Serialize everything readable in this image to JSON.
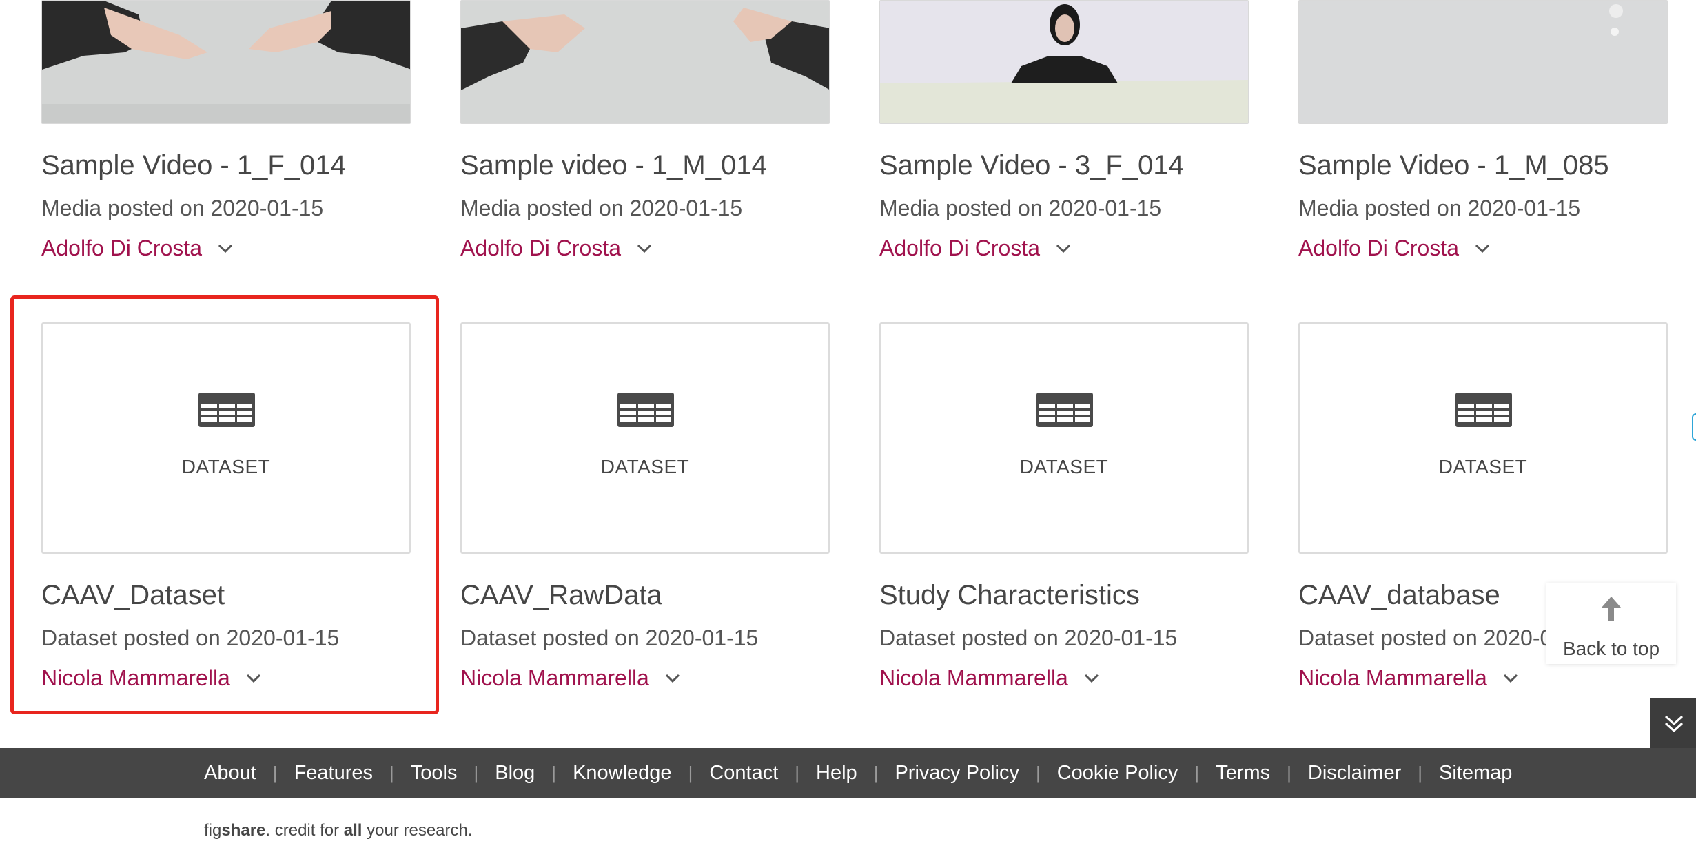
{
  "video_cards": [
    {
      "title": "Sample Video - 1_F_014",
      "posted": "Media posted on 2020-01-15",
      "author": "Adolfo Di Crosta",
      "thumb": "hands-on-table"
    },
    {
      "title": "Sample video - 1_M_014",
      "posted": "Media posted on 2020-01-15",
      "author": "Adolfo Di Crosta",
      "thumb": "hands-on-table"
    },
    {
      "title": "Sample Video - 3_F_014",
      "posted": "Media posted on 2020-01-15",
      "author": "Adolfo Di Crosta",
      "thumb": "person-at-table"
    },
    {
      "title": "Sample Video - 1_M_085",
      "posted": "Media posted on 2020-01-15",
      "author": "Adolfo Di Crosta",
      "thumb": "blank-table"
    }
  ],
  "dataset_cards": [
    {
      "type_label": "DATASET",
      "title": "CAAV_Dataset",
      "posted": "Dataset posted on 2020-01-15",
      "author": "Nicola Mammarella"
    },
    {
      "type_label": "DATASET",
      "title": "CAAV_RawData",
      "posted": "Dataset posted on 2020-01-15",
      "author": "Nicola Mammarella"
    },
    {
      "type_label": "DATASET",
      "title": "Study Characteristics",
      "posted": "Dataset posted on 2020-01-15",
      "author": "Nicola Mammarella"
    },
    {
      "type_label": "DATASET",
      "title": "CAAV_database",
      "posted": "Dataset posted on 2020-0",
      "author": "Nicola Mammarella"
    }
  ],
  "back_to_top": {
    "label": "Back to top",
    "icon": "arrow-up-icon"
  },
  "collapse_icon": "double-chevron-down-icon",
  "footer": {
    "links": [
      "About",
      "Features",
      "Tools",
      "Blog",
      "Knowledge",
      "Contact",
      "Help",
      "Privacy Policy",
      "Cookie Policy",
      "Terms",
      "Disclaimer",
      "Sitemap"
    ],
    "separator": "|"
  },
  "tagline": {
    "fig": "fig",
    "share": "share",
    "text1": ". credit for ",
    "all": "all",
    "text2": " your research."
  },
  "colors": {
    "author_link": "#a0124d",
    "highlight": "#e8251e",
    "footer_bg": "#464646",
    "accent_side": "#2ea6d8"
  }
}
